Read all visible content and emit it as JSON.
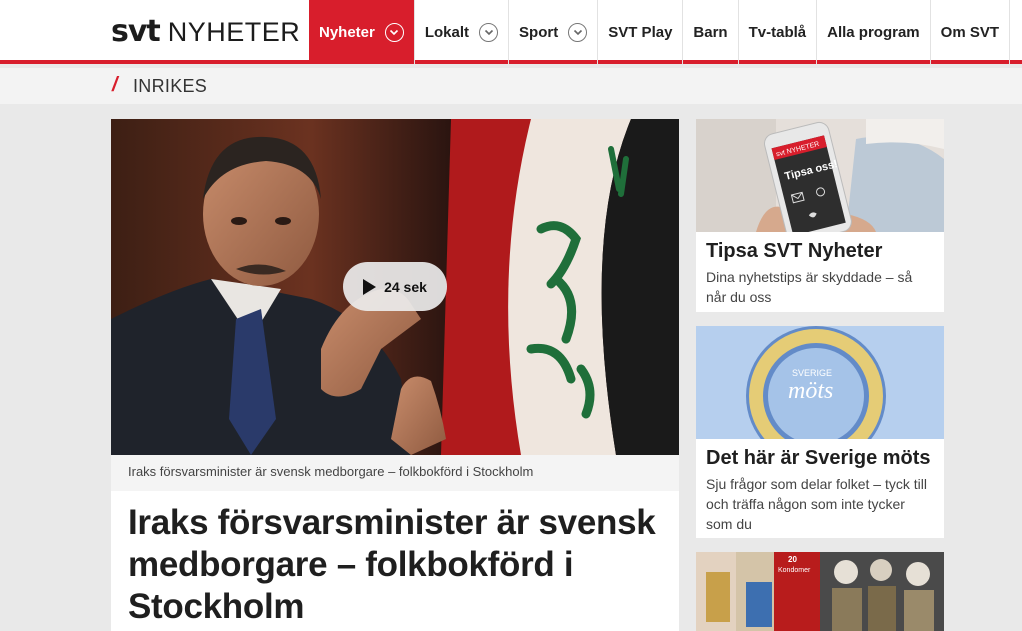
{
  "header": {
    "logo_svt": "svt",
    "logo_nyheter": "NYHETER",
    "nav": [
      {
        "label": "Nyheter",
        "has_dropdown": true,
        "active": true
      },
      {
        "label": "Lokalt",
        "has_dropdown": true,
        "active": false
      },
      {
        "label": "Sport",
        "has_dropdown": true,
        "active": false
      },
      {
        "label": "SVT Play",
        "has_dropdown": false,
        "active": false
      },
      {
        "label": "Barn",
        "has_dropdown": false,
        "active": false
      },
      {
        "label": "Tv-tablå",
        "has_dropdown": false,
        "active": false
      },
      {
        "label": "Alla program",
        "has_dropdown": false,
        "active": false
      },
      {
        "label": "Om SVT",
        "has_dropdown": false,
        "active": false
      }
    ]
  },
  "section": {
    "slash": "/",
    "title": "INRIKES"
  },
  "main_article": {
    "video_duration": "24 sek",
    "caption": "Iraks försvarsminister är svensk medborgare – folkbokförd i Stockholm",
    "headline": "Iraks försvarsminister är svensk medborgare – folkbokförd i Stockholm"
  },
  "sidebar": [
    {
      "title": "Tipsa SVT Nyheter",
      "text": "Dina nyhetstips är skyddade – så når du oss",
      "image_phone_header": "svt NYHETER",
      "image_phone_text": "Tipsa oss!"
    },
    {
      "title": "Det här är Sverige möts",
      "text": "Sju frågor som delar folket – tyck till och träffa någon som inte tycker som du",
      "image_logo_top": "SVERIGE",
      "image_logo_bottom": "möts"
    },
    {
      "title": "",
      "text": "",
      "image_label_number": "20",
      "image_label_text": "Kondomer"
    }
  ],
  "colors": {
    "brand_red": "#d81e2c",
    "background": "#e9e9e9"
  },
  "icons": [
    "chevron-down-icon",
    "play-icon",
    "mail-icon",
    "phone-icon",
    "twitter-icon"
  ]
}
